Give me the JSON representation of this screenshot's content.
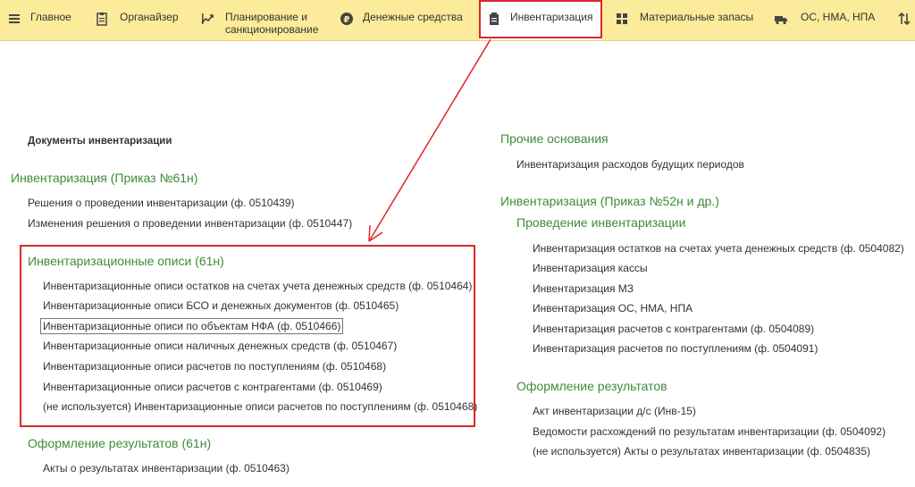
{
  "topbar": {
    "tabs": [
      {
        "label": "Главное",
        "icon": "hamburger-icon"
      },
      {
        "label": "Органайзер",
        "icon": "clipboard-icon"
      },
      {
        "label": "Планирование и\nсанкционирование",
        "icon": "planning-icon"
      },
      {
        "label": "Денежные средства",
        "icon": "ruble-icon"
      },
      {
        "label": "Инвентаризация",
        "icon": "inventory-icon"
      },
      {
        "label": "Материальные запасы",
        "icon": "grid-icon"
      },
      {
        "label": "ОС, НМА, НПА",
        "icon": "truck-icon"
      }
    ],
    "colors": {
      "background": "#fbeb9a",
      "highlight": "#d9272e"
    }
  },
  "left": {
    "section_title": "Документы инвентаризации",
    "group1": {
      "title": "Инвентаризация (Приказ №61н)",
      "items": [
        "Решения о проведении инвентаризации (ф. 0510439)",
        "Изменения решения о проведении инвентаризации (ф. 0510447)"
      ]
    },
    "group2": {
      "title": "Инвентаризационные описи (61н)",
      "items": [
        "Инвентаризационные описи остатков на счетах учета денежных средств (ф. 0510464)",
        "Инвентаризационные описи БСО и денежных документов (ф. 0510465)",
        "Инвентаризационные описи по объектам НФА (ф. 0510466)",
        "Инвентаризационные описи наличных денежных средств (ф. 0510467)",
        "Инвентаризационные описи расчетов по поступлениям (ф. 0510468)",
        "Инвентаризационные описи расчетов с контрагентами (ф. 0510469)",
        "(не используется) Инвентаризационные описи расчетов по поступлениям (ф. 0510468)"
      ]
    },
    "group3": {
      "title": "Оформление результатов (61н)",
      "items": [
        "Акты о результатах инвентаризации (ф. 0510463)"
      ]
    }
  },
  "right": {
    "group1": {
      "title": "Прочие основания",
      "items": [
        "Инвентаризация расходов будущих периодов"
      ]
    },
    "group2": {
      "title": "Инвентаризация (Приказ №52н и др.)",
      "subtitle": "Проведение инвентаризации",
      "items": [
        "Инвентаризация остатков на счетах учета денежных средств (ф. 0504082)",
        "Инвентаризация кассы",
        "Инвентаризация МЗ",
        "Инвентаризация ОС, НМА, НПА",
        "Инвентаризация расчетов с контрагентами (ф. 0504089)",
        "Инвентаризация расчетов по поступлениям (ф. 0504091)"
      ],
      "subtitle2": "Оформление результатов",
      "items2": [
        "Акт инвентаризации д/с (Инв-15)",
        "Ведомости расхождений по результатам инвентаризации (ф. 0504092)",
        "(не используется) Акты о результатах инвентаризации (ф. 0504835)"
      ]
    }
  }
}
